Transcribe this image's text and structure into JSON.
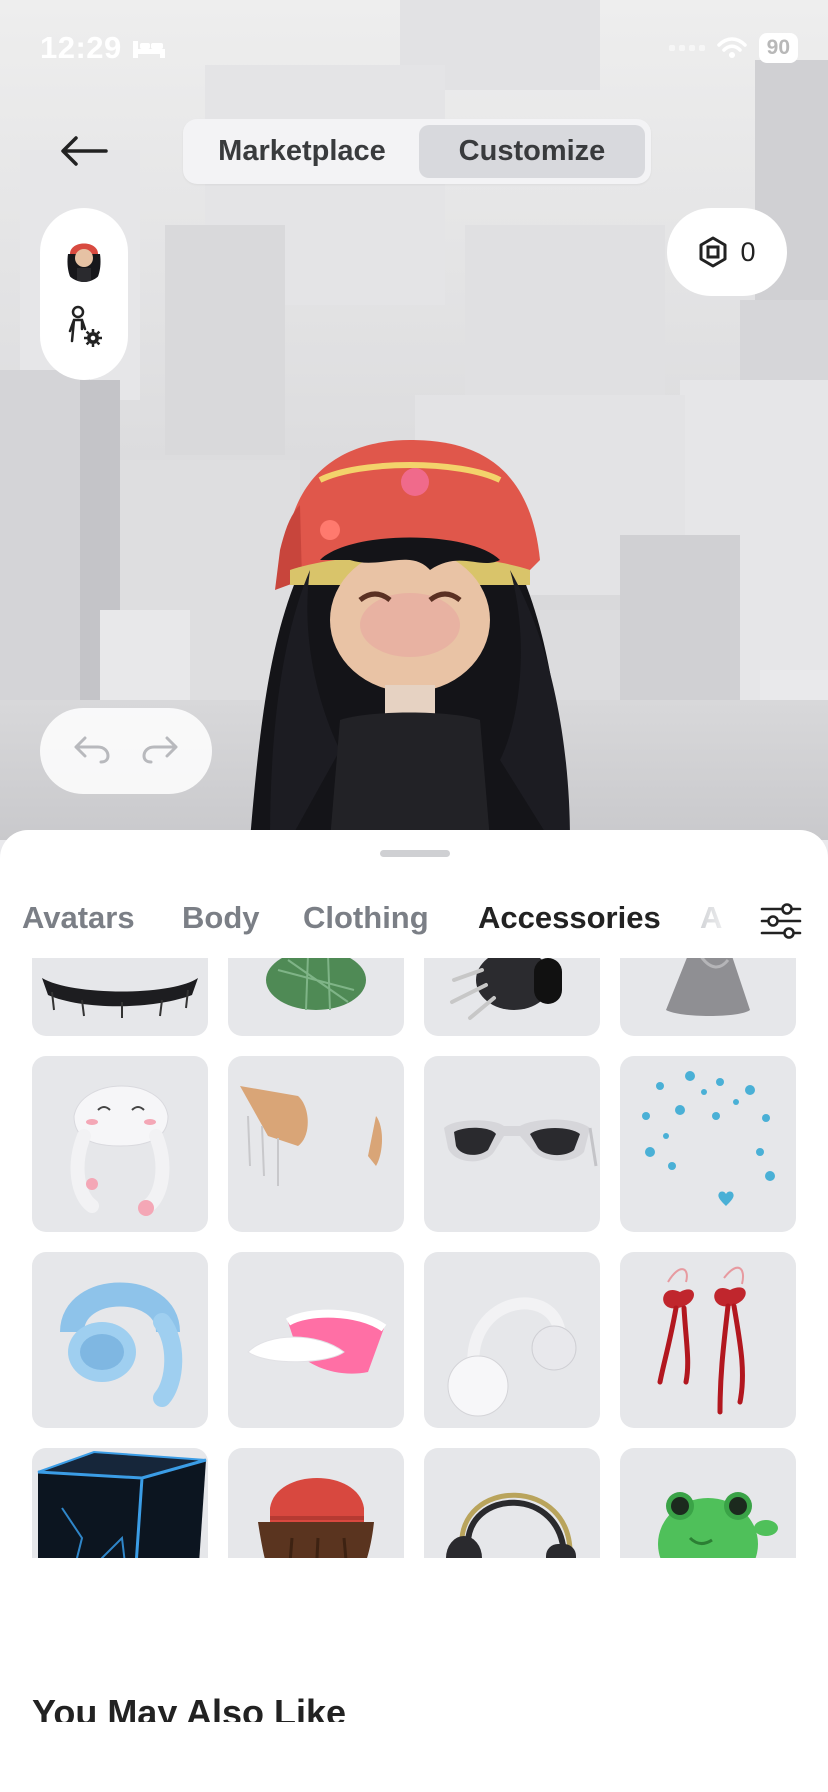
{
  "status_bar": {
    "time": "12:29",
    "battery": "90"
  },
  "header": {
    "tabs": [
      {
        "label": "Marketplace",
        "active": false
      },
      {
        "label": "Customize",
        "active": true
      }
    ],
    "robux_balance": "0"
  },
  "categories": [
    {
      "label": "Avatars",
      "active": false
    },
    {
      "label": "Body",
      "active": false
    },
    {
      "label": "Clothing",
      "active": false
    },
    {
      "label": "Accessories",
      "active": true
    },
    {
      "label": "A",
      "active": false
    }
  ],
  "items": [
    {
      "name": "black-lace-hat-item"
    },
    {
      "name": "green-plaid-beret-item"
    },
    {
      "name": "spiked-paw-item"
    },
    {
      "name": "gray-ghost-item"
    },
    {
      "name": "white-bunny-hat-item"
    },
    {
      "name": "elf-ears-item"
    },
    {
      "name": "white-sunglasses-item"
    },
    {
      "name": "blue-hearts-aura-item"
    },
    {
      "name": "blue-bunny-headphones-item"
    },
    {
      "name": "pink-visor-item"
    },
    {
      "name": "white-earmuffs-item"
    },
    {
      "name": "red-ribbon-bows-item"
    },
    {
      "name": "neon-cube-head-item"
    },
    {
      "name": "brown-hair-red-beanie-item"
    },
    {
      "name": "black-gold-headphones-item"
    },
    {
      "name": "green-frog-head-item"
    }
  ],
  "section_title": "You May Also Like",
  "colors": {
    "accent_dark": "#222222",
    "tile_bg": "#e6e7ea",
    "inactive_tab": "#7b7f86"
  }
}
